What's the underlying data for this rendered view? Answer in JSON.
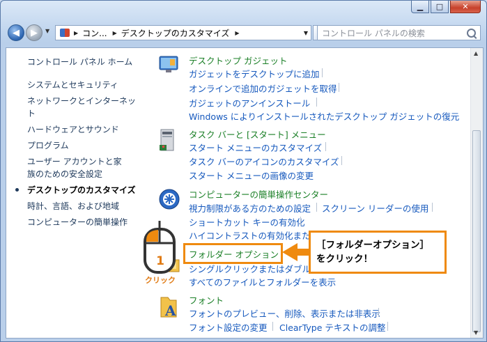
{
  "caption": {
    "minimize": "▁",
    "maximize": "□",
    "close": "✕"
  },
  "address": {
    "crumbs": [
      "コン...",
      "デスクトップのカスタマイズ"
    ],
    "search_placeholder": "コントロール パネルの検索"
  },
  "sidebar": {
    "home": "コントロール パネル ホーム",
    "items": [
      "システムとセキュリティ",
      "ネットワークとインターネット",
      "ハードウェアとサウンド",
      "プログラム",
      "ユーザー アカウントと家族のための安全設定",
      "デスクトップのカスタマイズ",
      "時計、言語、および地域",
      "コンピューターの簡単操作"
    ],
    "current_index": 5
  },
  "sections": {
    "gadgets": {
      "title": "デスクトップ ガジェット",
      "links": [
        "ガジェットをデスクトップに追加",
        "オンラインで追加のガジェットを取得",
        "ガジェットのアンインストール",
        "Windows によりインストールされたデスクトップ ガジェットの復元"
      ]
    },
    "taskbar": {
      "title": "タスク バーと [スタート] メニュー",
      "links": [
        "スタート メニューのカスタマイズ",
        "タスク バーのアイコンのカスタマイズ",
        "スタート メニューの画像の変更"
      ]
    },
    "ease": {
      "title": "コンピューターの簡単操作センター",
      "links": [
        "視力制限がある方のための設定",
        "スクリーン リーダーの使用",
        "ショートカット キーの有効化",
        "ハイコントラストの有効化また"
      ]
    },
    "folder": {
      "title": "フォルダー オプション",
      "links": [
        "シングルクリックまたはダブル",
        "すべてのファイルとフォルダーを表示"
      ]
    },
    "fonts": {
      "title": "フォント",
      "links": [
        "フォントのプレビュー、削除、表示または非表示",
        "フォント設定の変更",
        "ClearType テキストの調整"
      ]
    }
  },
  "annotation": {
    "step": "1",
    "click": "クリック",
    "callout_line1": "［フォルダーオプション］",
    "callout_line2": "をクリック！"
  },
  "colors": {
    "accent": "#ef8a0f",
    "link": "#1558bd",
    "header": "#1a7f26"
  }
}
